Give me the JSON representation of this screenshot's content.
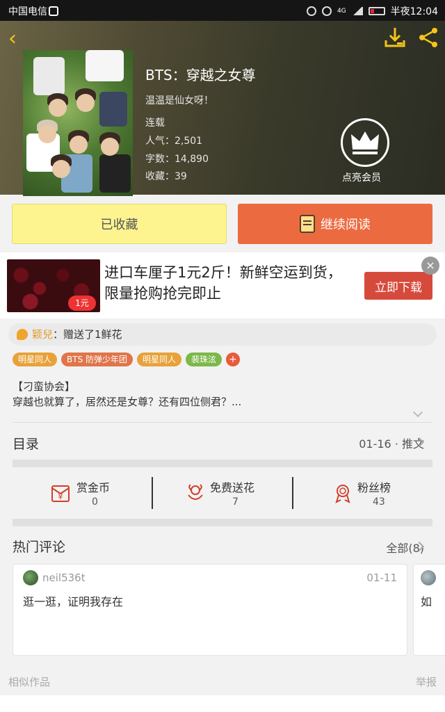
{
  "status_bar": {
    "carrier": "中国电信",
    "network": "4G",
    "time": "半夜12:04"
  },
  "book": {
    "title": "BTS：穿越之女尊",
    "author": "温温是仙女呀！",
    "status": "连载",
    "popularity": "人气：2,501",
    "words": "字数：14,890",
    "favorites": "收藏：39",
    "vip_label": "点亮会员"
  },
  "buttons": {
    "favorited": "已收藏",
    "continue_read": "继续阅读"
  },
  "ad": {
    "badge": "1元",
    "text": "进口车厘子1元2斤！新鲜空运到货，限量抢购抢完即止",
    "cta": "立即下载",
    "close": "×"
  },
  "notice": {
    "user": "颖兒",
    "message": "：赠送了1鲜花"
  },
  "tags": [
    {
      "label": "明星同人",
      "color": "#e8a23a"
    },
    {
      "label": "BTS 防弹少年团",
      "color": "#e0754a"
    },
    {
      "label": "明星同人",
      "color": "#e8a23a"
    },
    {
      "label": "裴珠泫",
      "color": "#7cb84a"
    }
  ],
  "tag_more": "+",
  "intro": {
    "line1": "【刁蛮协会】",
    "line2": "穿越也就算了，居然还是女尊？还有四位侧君？..."
  },
  "catalog": {
    "title": "目录",
    "latest": "01-16 · 推文"
  },
  "actions": [
    {
      "label": "赏金币",
      "value": "0",
      "icon": "coin-envelope-icon"
    },
    {
      "label": "免费送花",
      "value": "7",
      "icon": "flower-icon"
    },
    {
      "label": "粉丝榜",
      "value": "43",
      "icon": "medal-icon"
    }
  ],
  "comments": {
    "title": "热门评论",
    "all": "全部(8)",
    "items": [
      {
        "user": "neil536t",
        "date": "01-11",
        "text": "逛一逛，证明我存在"
      },
      {
        "user": "",
        "date": "",
        "text": "如"
      }
    ]
  },
  "footer": {
    "similar": "相似作品",
    "report": "举报"
  },
  "colors": {
    "accent_yellow": "#f5c518",
    "read_button": "#ec6a3f",
    "fav_button": "#fdf490",
    "icon_red": "#d0402c"
  }
}
